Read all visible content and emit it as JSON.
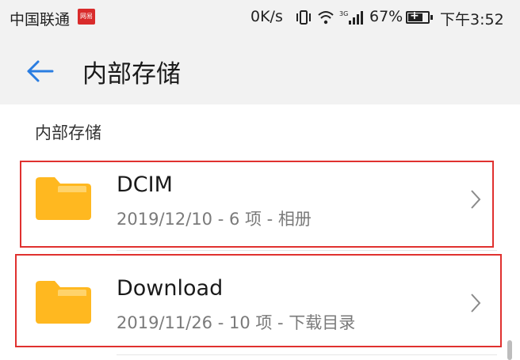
{
  "status_bar": {
    "carrier": "中国联通",
    "carrier_badge": "网易",
    "net_speed": "0K/s",
    "signal_tag": "3G",
    "battery_percent": "67%",
    "time": "下午3:52"
  },
  "toolbar": {
    "title": "内部存储"
  },
  "section": {
    "header": "内部存储"
  },
  "items": [
    {
      "name": "DCIM",
      "meta": "2019/12/10 - 6 项 - 相册"
    },
    {
      "name": "Download",
      "meta": "2019/11/26 - 10 项 - 下载目录"
    }
  ],
  "colors": {
    "accent": "#2a7de1",
    "folder": "#ffb820",
    "folder_tab": "#ffd36b",
    "highlight": "#e0312f"
  }
}
